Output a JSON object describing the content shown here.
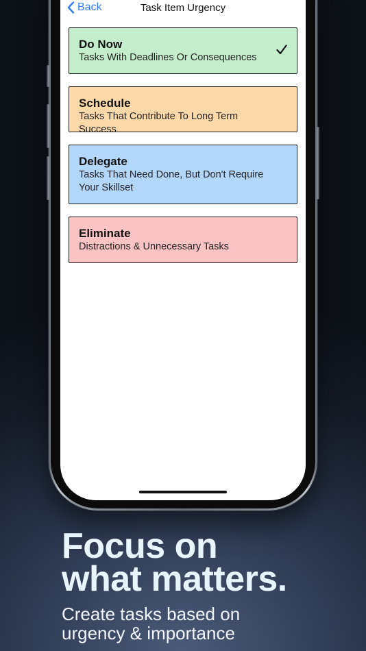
{
  "nav": {
    "back_label": "Back",
    "title": "Task Item Urgency"
  },
  "options": [
    {
      "title": "Do Now",
      "description": "Tasks With Deadlines Or Consequences",
      "color": "#c4edcb",
      "selected": true
    },
    {
      "title": "Schedule",
      "description": "Tasks That Contribute To Long Term Success",
      "color": "#fdd8a8",
      "selected": false
    },
    {
      "title": "Delegate",
      "description": "Tasks That Need Done, But Don't Require Your Skillset",
      "color": "#b3d6fb",
      "selected": false
    },
    {
      "title": "Eliminate",
      "description": "Distractions & Unnecessary Tasks",
      "color": "#fbc3c3",
      "selected": false
    }
  ],
  "icons": {
    "back": "chevron-left-icon",
    "selected": "checkmark-icon"
  },
  "colors": {
    "accent": "#2f7cf6",
    "headline": "#e8f5ff"
  },
  "marketing": {
    "headline_line1": "Focus on",
    "headline_line2": "what matters.",
    "subhead_line1": "Create tasks based on",
    "subhead_line2": "urgency & importance"
  }
}
